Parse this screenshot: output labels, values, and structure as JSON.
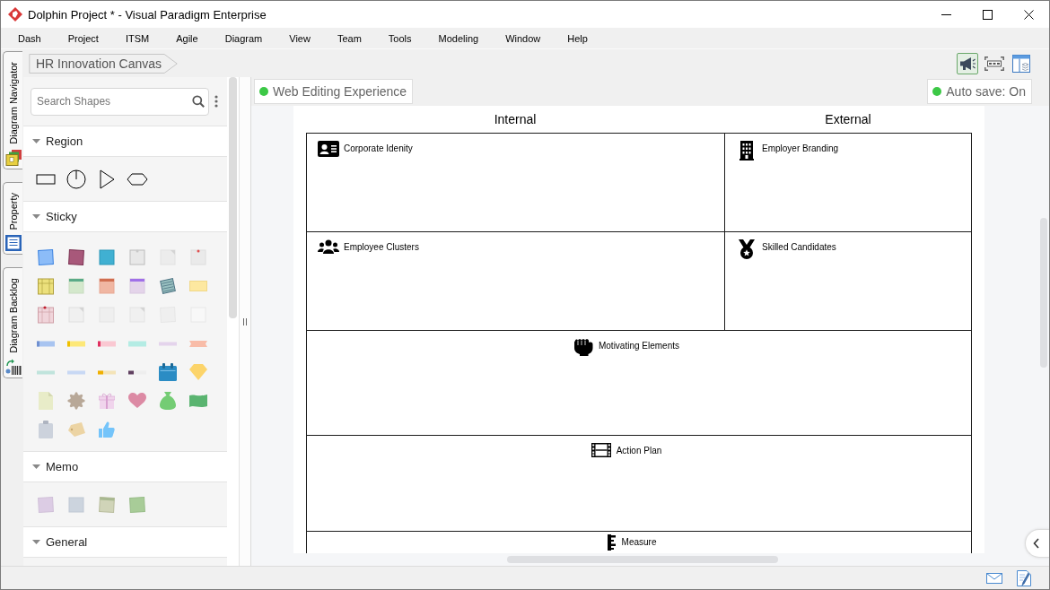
{
  "window": {
    "title": "Dolphin Project * - Visual Paradigm Enterprise"
  },
  "menu": [
    "Dash",
    "Project",
    "ITSM",
    "Agile",
    "Diagram",
    "View",
    "Team",
    "Tools",
    "Modeling",
    "Window",
    "Help"
  ],
  "side_tabs": [
    "Diagram Navigator",
    "Property",
    "Diagram Backlog"
  ],
  "breadcrumb": "HR Innovation Canvas",
  "toolbar_buttons": [
    {
      "on": true
    },
    {
      "on": false
    },
    {
      "on": false
    }
  ],
  "shape_panel": {
    "search": {
      "placeholder": "Search Shapes"
    },
    "sections": [
      {
        "title": "Region",
        "kind": "region",
        "expanded": true
      },
      {
        "title": "Sticky",
        "kind": "sticky",
        "expanded": true
      },
      {
        "title": "Memo",
        "kind": "memo",
        "expanded": true
      },
      {
        "title": "General",
        "kind": "general",
        "expanded": true
      }
    ]
  },
  "status_chips": [
    {
      "label": "Web Editing Experience",
      "on": true
    },
    {
      "label": "Auto save: On",
      "on": true
    }
  ],
  "canvas": {
    "column_headers": [
      "Internal",
      "External"
    ],
    "rows": [
      [
        "Corporate Idenity",
        "Employer Branding"
      ],
      [
        "Employee Clusters",
        "Skilled Candidates"
      ],
      [
        "Motivating Elements"
      ],
      [
        "Action Plan"
      ],
      [
        "Measure"
      ]
    ]
  }
}
